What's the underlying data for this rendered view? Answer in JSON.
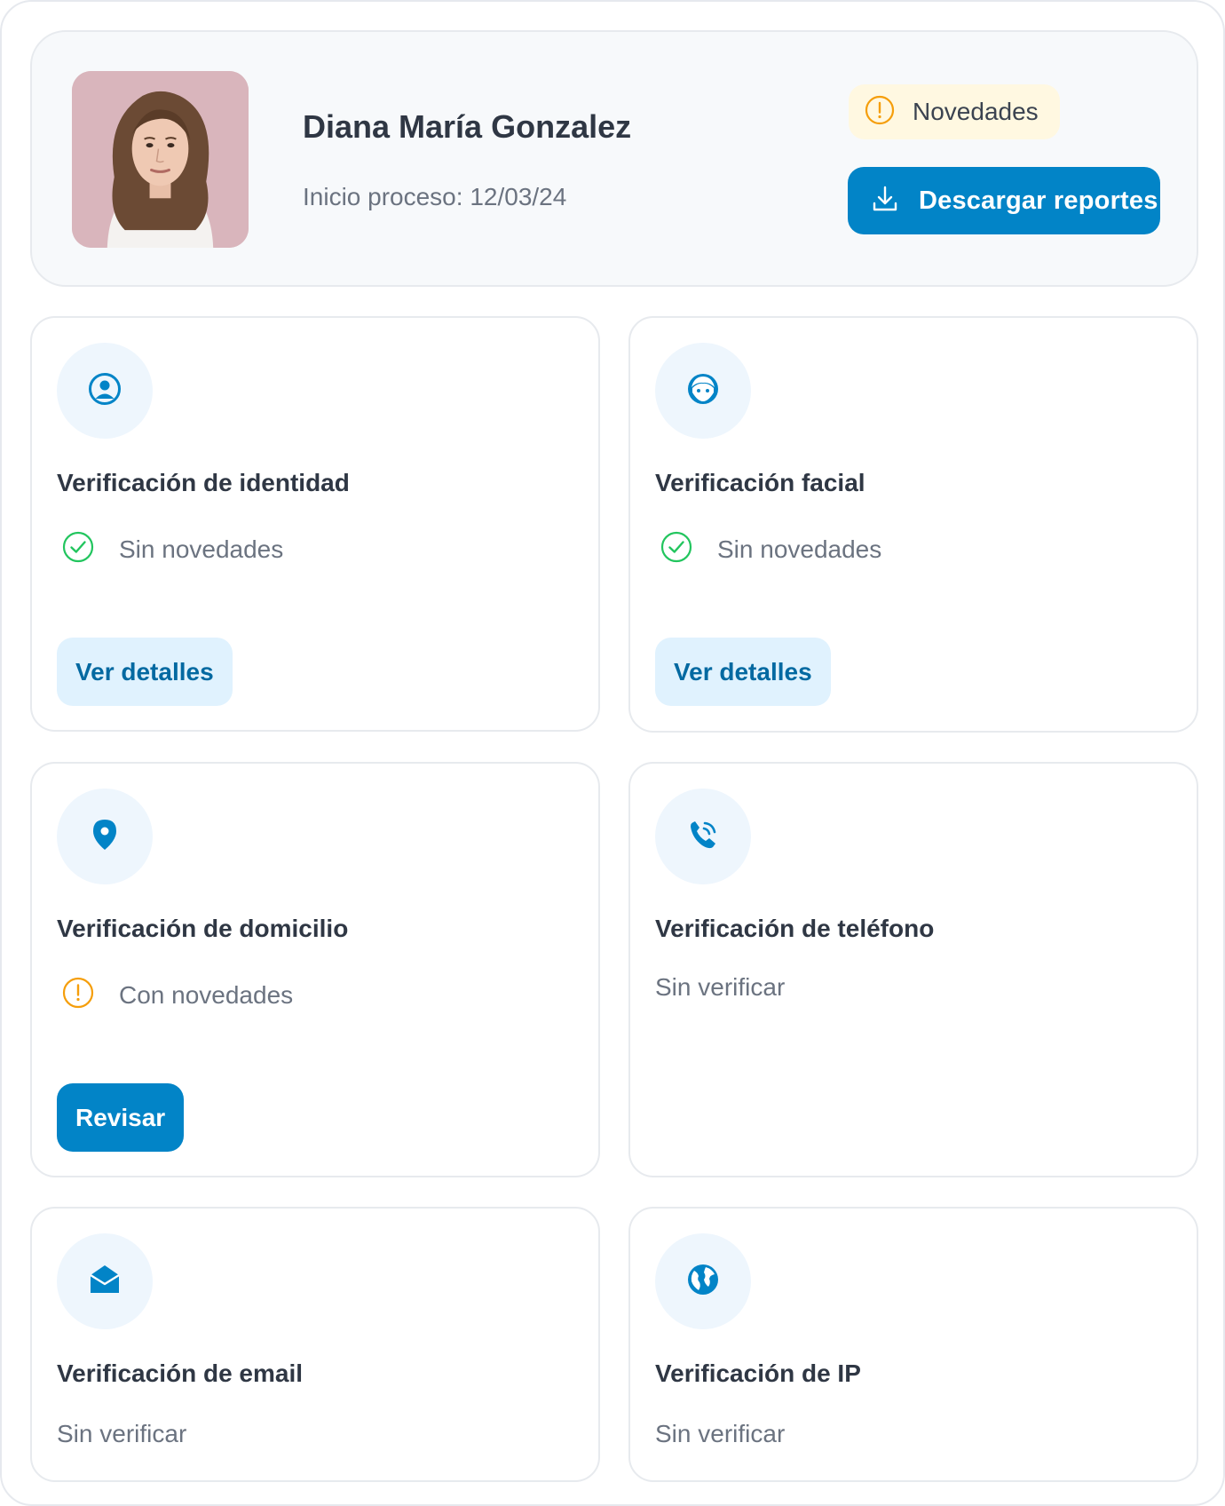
{
  "profile": {
    "name": "Diana María Gonzalez",
    "started": "Inicio proceso: 12/03/24",
    "badge_label": "Novedades",
    "download_label": "Descargar reportes"
  },
  "colors": {
    "primary": "#0284c7",
    "success": "#22c55e",
    "warning": "#f59e0b"
  },
  "cards": [
    {
      "title": "Verificación de identidad",
      "icon": "user-circle-icon",
      "status": "Sin novedades",
      "status_icon": "check-circle-icon",
      "button": "Ver detalles"
    },
    {
      "title": "Verificación facial",
      "icon": "face-icon",
      "status": "Sin novedades",
      "status_icon": "check-circle-icon",
      "button": "Ver detalles"
    },
    {
      "title": "Verificación de domicilio",
      "icon": "map-pin-icon",
      "status": "Con novedades",
      "status_icon": "warning-circle-icon",
      "button": "Revisar"
    },
    {
      "title": "Verificación de teléfono",
      "icon": "phone-icon",
      "status": "Sin verificar"
    },
    {
      "title": "Verificación de email",
      "icon": "envelope-open-icon",
      "status": "Sin verificar"
    },
    {
      "title": "Verificación de IP",
      "icon": "globe-icon",
      "status": "Sin verificar"
    }
  ]
}
